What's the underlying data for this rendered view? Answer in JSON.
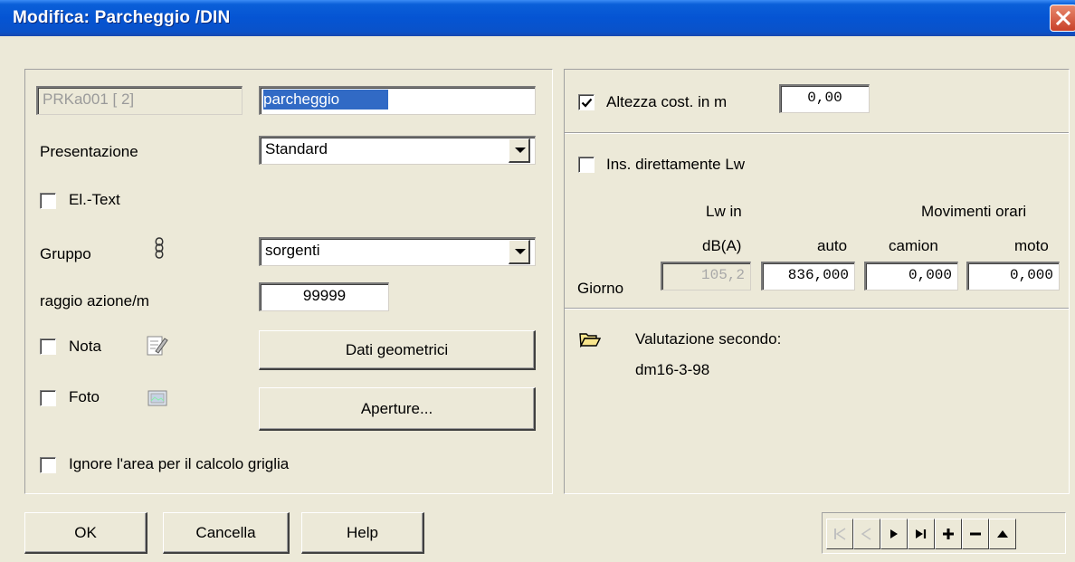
{
  "window": {
    "title": "Modifica:  Parcheggio /DIN"
  },
  "left": {
    "id_field": "PRKa001  [ 2]",
    "name_field": "parcheggio",
    "presentazione_label": "Presentazione",
    "presentazione_value": "Standard",
    "eltext_label": "El.-Text",
    "eltext_checked": false,
    "gruppo_label": "Gruppo",
    "gruppo_value": "sorgenti",
    "raggio_label": "raggio azione/m",
    "raggio_value": "99999",
    "nota_label": "Nota",
    "nota_checked": false,
    "dati_button": "Dati geometrici",
    "foto_label": "Foto",
    "foto_checked": false,
    "aperture_button": "Aperture...",
    "ignore_label": "Ignore l'area per il calcolo griglia",
    "ignore_checked": false
  },
  "right": {
    "altezza_label": "Altezza cost. in m",
    "altezza_checked": true,
    "altezza_value": "0,00",
    "lw_direct_label": "Ins. direttamente Lw",
    "lw_direct_checked": false,
    "lw_header_1": "Lw in",
    "lw_header_2": "dB(A)",
    "mov_header": "Movimenti orari",
    "col_auto": "auto",
    "col_camion": "camion",
    "col_moto": "moto",
    "row_label": "Giorno",
    "lw_value": "105,2",
    "auto_value": "836,000",
    "camion_value": "0,000",
    "moto_value": "0,000",
    "valutazione_label": "Valutazione secondo:",
    "valutazione_value": "dm16-3-98"
  },
  "footer": {
    "ok_label": "OK",
    "cancel_label": "Cancella",
    "help_label": "Help"
  },
  "icons": {
    "gruppo": "chain-link-icon",
    "nota": "note-pencil-icon",
    "foto": "photo-icon",
    "folder": "open-folder-icon",
    "nav": [
      "first-record-icon",
      "prev-record-icon",
      "next-record-icon",
      "last-record-icon",
      "plus-icon",
      "minus-icon",
      "up-arrow-icon"
    ]
  },
  "colors": {
    "titlebar": "#0554d3",
    "selection": "#316ac5",
    "dialog_bg": "#ece9d8",
    "close_button": "#c8412a"
  }
}
